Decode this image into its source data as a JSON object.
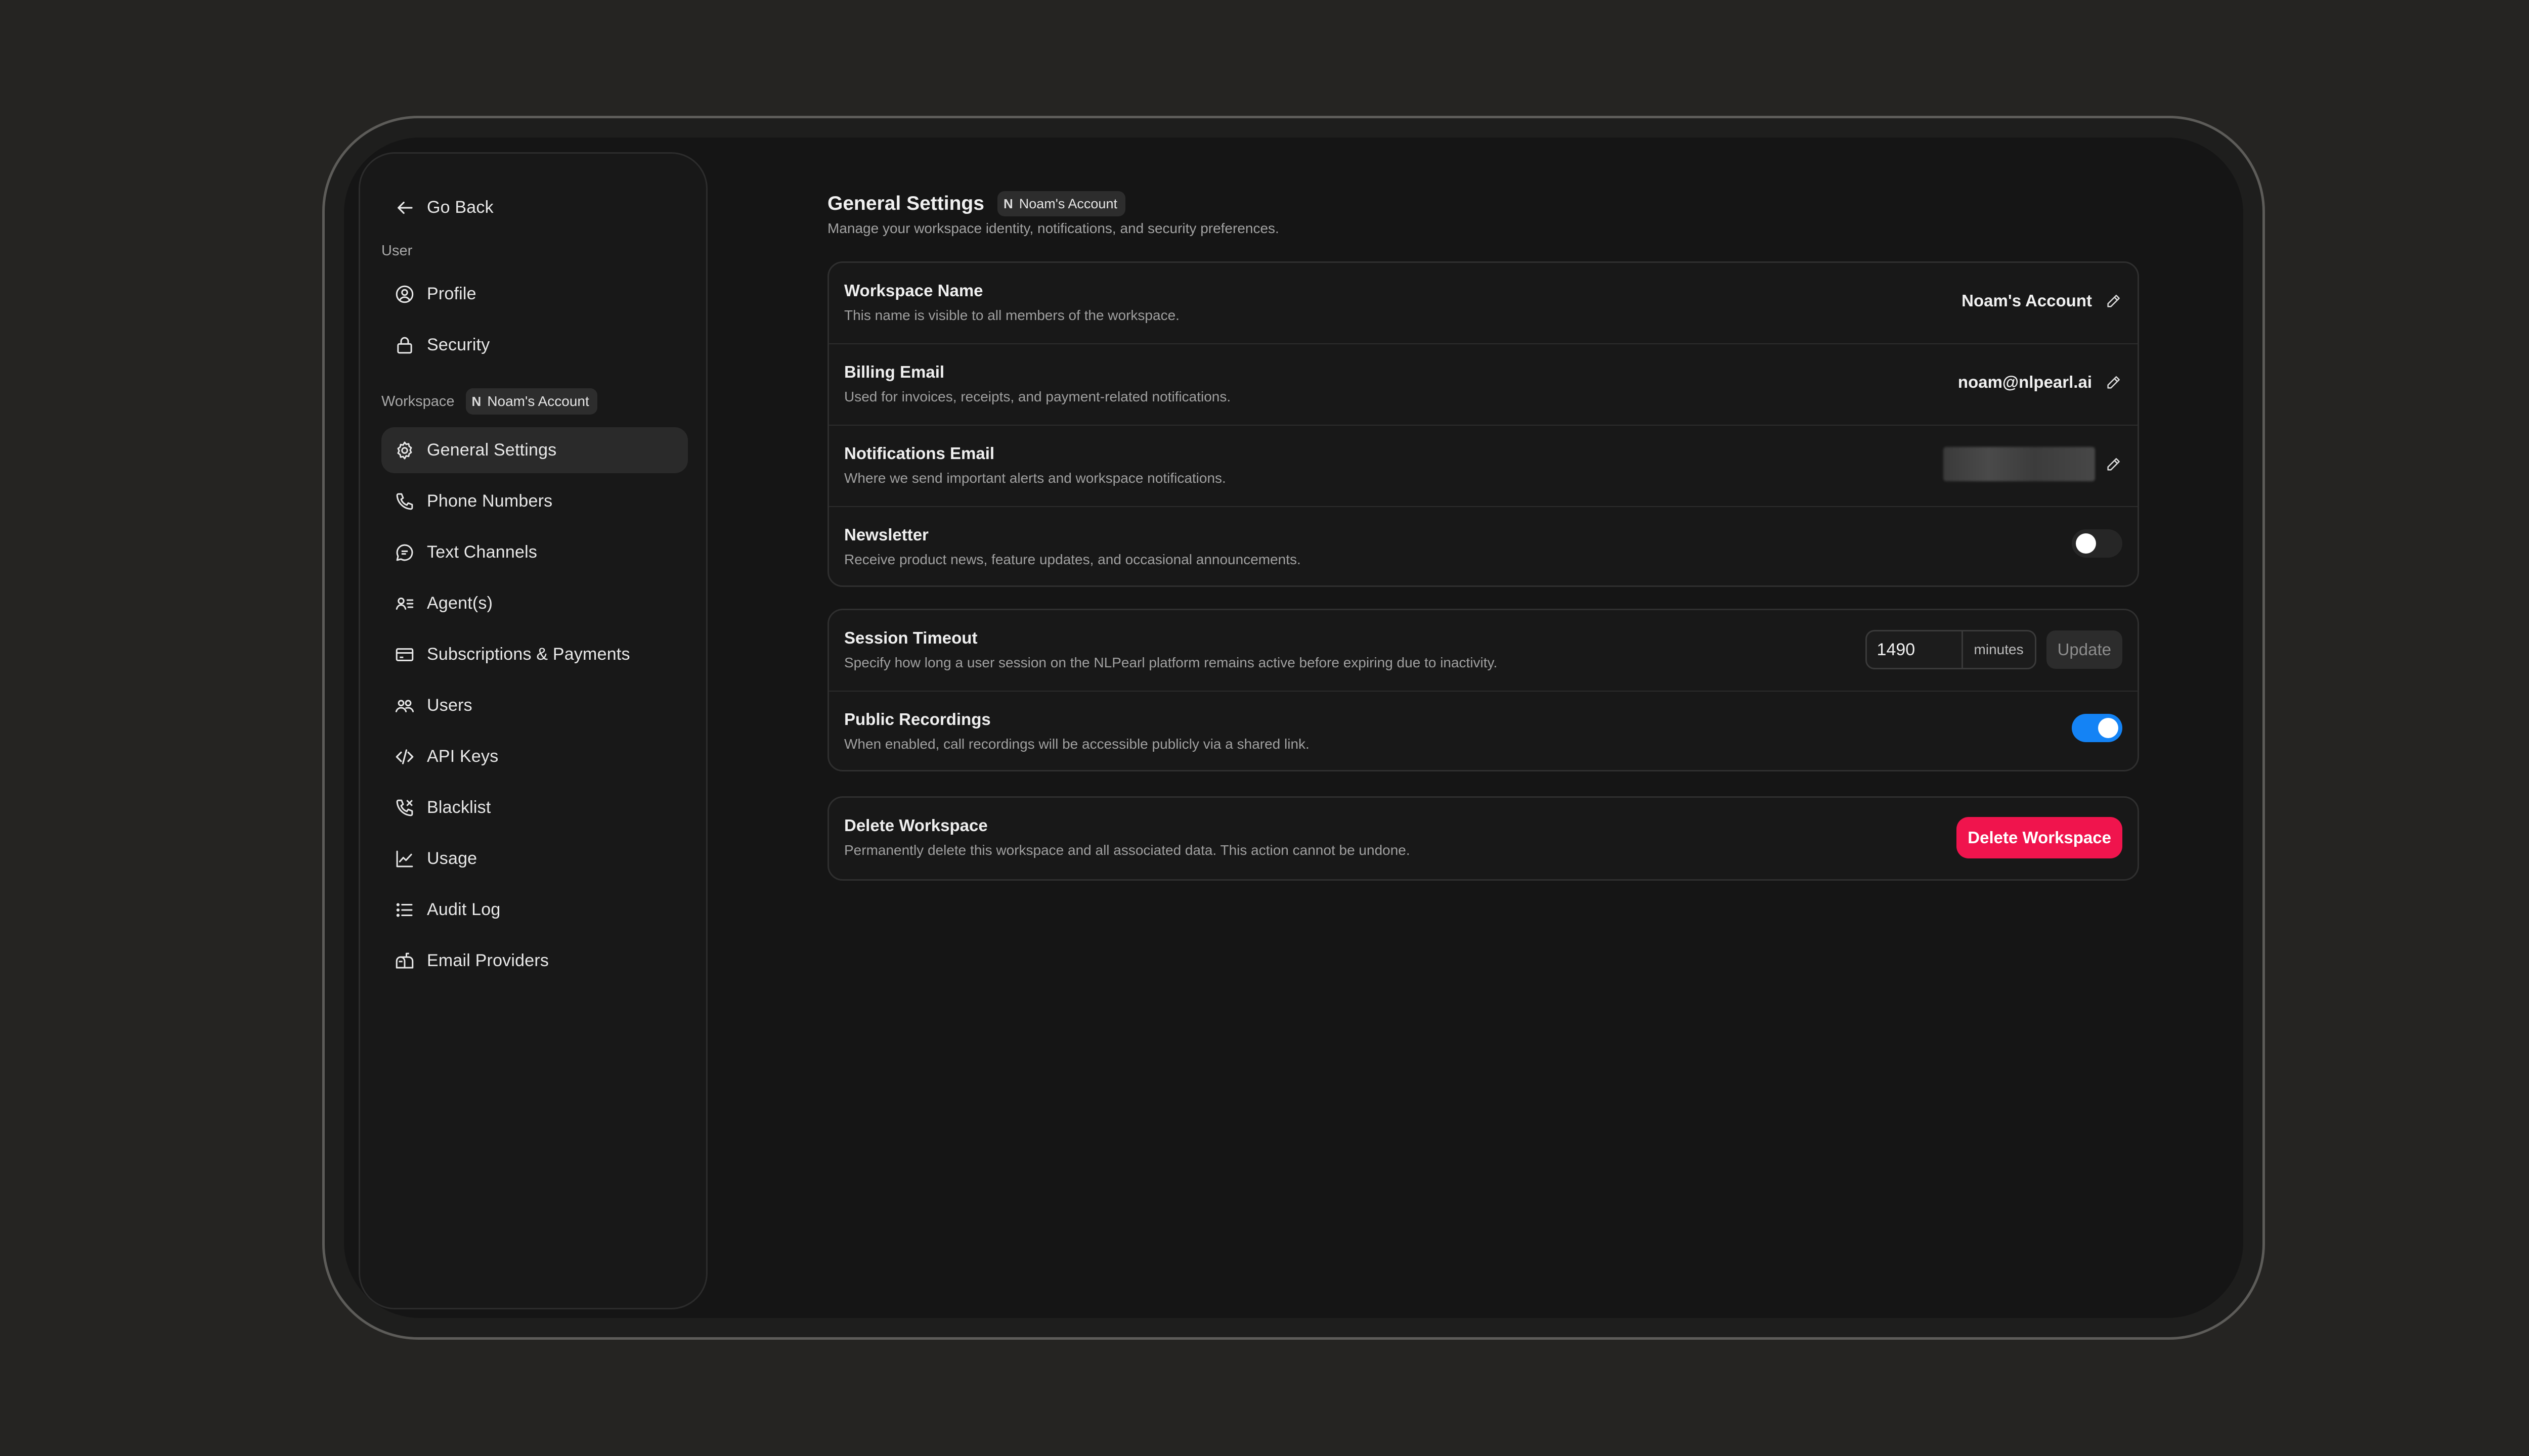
{
  "sidebar": {
    "back_label": "Go Back",
    "user_section_label": "User",
    "user_items": [
      {
        "label": "Profile",
        "icon": "user-circle-icon"
      },
      {
        "label": "Security",
        "icon": "lock-icon"
      }
    ],
    "workspace_section_label": "Workspace",
    "workspace_chip": {
      "initial": "N",
      "name": "Noam's Account"
    },
    "workspace_items": [
      {
        "label": "General Settings",
        "icon": "gear-icon",
        "active": true
      },
      {
        "label": "Phone Numbers",
        "icon": "phone-icon"
      },
      {
        "label": "Text Channels",
        "icon": "chat-bubble-icon"
      },
      {
        "label": "Agent(s)",
        "icon": "agent-list-icon"
      },
      {
        "label": "Subscriptions & Payments",
        "icon": "credit-card-icon"
      },
      {
        "label": "Users",
        "icon": "users-icon"
      },
      {
        "label": "API Keys",
        "icon": "code-icon"
      },
      {
        "label": "Blacklist",
        "icon": "phone-blocked-icon"
      },
      {
        "label": "Usage",
        "icon": "chart-line-icon"
      },
      {
        "label": "Audit Log",
        "icon": "list-icon"
      },
      {
        "label": "Email Providers",
        "icon": "mailbox-icon"
      }
    ]
  },
  "header": {
    "title": "General Settings",
    "chip": {
      "initial": "N",
      "name": "Noam's Account"
    },
    "subtitle": "Manage your workspace identity, notifications, and security preferences."
  },
  "settings": {
    "workspace_name": {
      "title": "Workspace Name",
      "description": "This name is visible to all members of the workspace.",
      "value": "Noam's Account"
    },
    "billing_email": {
      "title": "Billing Email",
      "description": "Used for invoices, receipts, and payment-related notifications.",
      "value": "noam@nlpearl.ai"
    },
    "notifications_email": {
      "title": "Notifications Email",
      "description": "Where we send important alerts and workspace notifications."
    },
    "newsletter": {
      "title": "Newsletter",
      "description": "Receive product news, feature updates, and occasional announcements.",
      "enabled": false
    },
    "session_timeout": {
      "title": "Session Timeout",
      "description": "Specify how long a user session on the NLPearl platform remains active before expiring due to inactivity.",
      "value": "1490",
      "unit": "minutes",
      "button_label": "Update"
    },
    "public_recordings": {
      "title": "Public Recordings",
      "description": "When enabled, call recordings will be accessible publicly via a shared link.",
      "enabled": true
    },
    "delete_workspace": {
      "title": "Delete Workspace",
      "description": "Permanently delete this workspace and all associated data. This action cannot be undone.",
      "button_label": "Delete Workspace"
    }
  },
  "colors": {
    "accent_blue": "#1483f5",
    "danger": "#f0144d"
  }
}
